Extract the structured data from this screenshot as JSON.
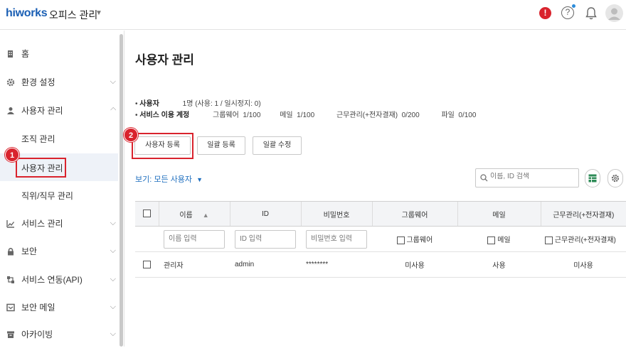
{
  "brand": {
    "logo": "hiworks",
    "app_title": "오피스 관리"
  },
  "sidebar": {
    "items": [
      {
        "label": "홈",
        "icon": "building-icon"
      },
      {
        "label": "환경 설정",
        "icon": "gear-icon"
      },
      {
        "label": "사용자 관리",
        "icon": "person-icon"
      },
      {
        "label": "서비스 관리",
        "icon": "chart-icon"
      },
      {
        "label": "보안",
        "icon": "lock-icon"
      },
      {
        "label": "서비스 연동(API)",
        "icon": "api-icon"
      },
      {
        "label": "보안 메일",
        "icon": "mail-icon"
      },
      {
        "label": "아카이빙",
        "icon": "archive-icon"
      }
    ],
    "sub_items": [
      "조직 관리",
      "사용자 관리",
      "직위/직무 관리"
    ]
  },
  "markers": {
    "m1": "1",
    "m2": "2"
  },
  "main": {
    "title": "사용자 관리",
    "summary": {
      "users_label": "사용자",
      "users_value": "1명 (사용: 1 / 일시정지: 0)",
      "service_label": "서비스 이용 계정",
      "groupware": "그룹웨어  1/100",
      "mail": "메일  1/100",
      "attendance": "근무관리(+전자결재)  0/200",
      "file": "파일  0/100"
    },
    "buttons": {
      "register": "사용자 등록",
      "bulk_register": "일괄 등록",
      "bulk_edit": "일괄 수정"
    },
    "view_filter": "보기: 모든 사용자",
    "search_placeholder": "이름, ID 검색"
  },
  "table": {
    "headers": [
      "이름",
      "ID",
      "비밀번호",
      "그룹웨어",
      "메일",
      "근무관리(+전자결재)"
    ],
    "filters": {
      "name_placeholder": "이름 입력",
      "id_placeholder": "ID 입력",
      "pw_placeholder": "비밀번호 입력",
      "groupware": "그룹웨어",
      "mail": "메일",
      "attendance": "근무관리(+전자결재)"
    },
    "rows": [
      {
        "name": "관리자",
        "id": "admin",
        "password": "********",
        "groupware": "미사용",
        "mail": "사용",
        "attendance": "미사용"
      }
    ]
  },
  "colors": {
    "accent": "#1f6fbf",
    "highlight": "#d9232d",
    "alert": "#d9232d"
  }
}
